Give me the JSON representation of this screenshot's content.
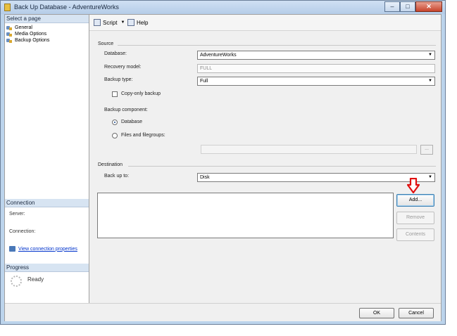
{
  "window": {
    "title": "Back Up Database - AdventureWorks",
    "controls": {
      "minimize": "–",
      "maximize": "□",
      "close": "✕"
    }
  },
  "left_pane": {
    "select_page_header": "Select a page",
    "pages": [
      {
        "label": "General",
        "icon": "page-icon"
      },
      {
        "label": "Media Options",
        "icon": "page-icon"
      },
      {
        "label": "Backup Options",
        "icon": "page-icon"
      }
    ],
    "connection_header": "Connection",
    "server_label": "Server:",
    "connection_label": "Connection:",
    "view_connection_link": "View connection properties",
    "progress_header": "Progress",
    "progress_status": "Ready"
  },
  "toolbar": {
    "script_label": "Script",
    "help_label": "Help"
  },
  "source": {
    "group_label": "Source",
    "database_label": "Database:",
    "database_value": "AdventureWorks",
    "recovery_model_label": "Recovery model:",
    "recovery_model_value": "FULL",
    "backup_type_label": "Backup type:",
    "backup_type_value": "Full",
    "copy_only_label": "Copy-only backup",
    "copy_only_checked": false,
    "backup_component_label": "Backup component:",
    "component_database_label": "Database",
    "component_files_label": "Files and filegroups:",
    "selected_component": "Database",
    "browse_label": "..."
  },
  "destination": {
    "group_label": "Destination",
    "back_up_to_label": "Back up to:",
    "back_up_to_value": "Disk",
    "buttons": {
      "add": "Add...",
      "remove": "Remove",
      "contents": "Contents"
    }
  },
  "footer": {
    "ok": "OK",
    "cancel": "Cancel"
  },
  "colors": {
    "annotation_arrow": "#e01010",
    "window_frame": "#bcd4ec",
    "link": "#0033cc"
  }
}
